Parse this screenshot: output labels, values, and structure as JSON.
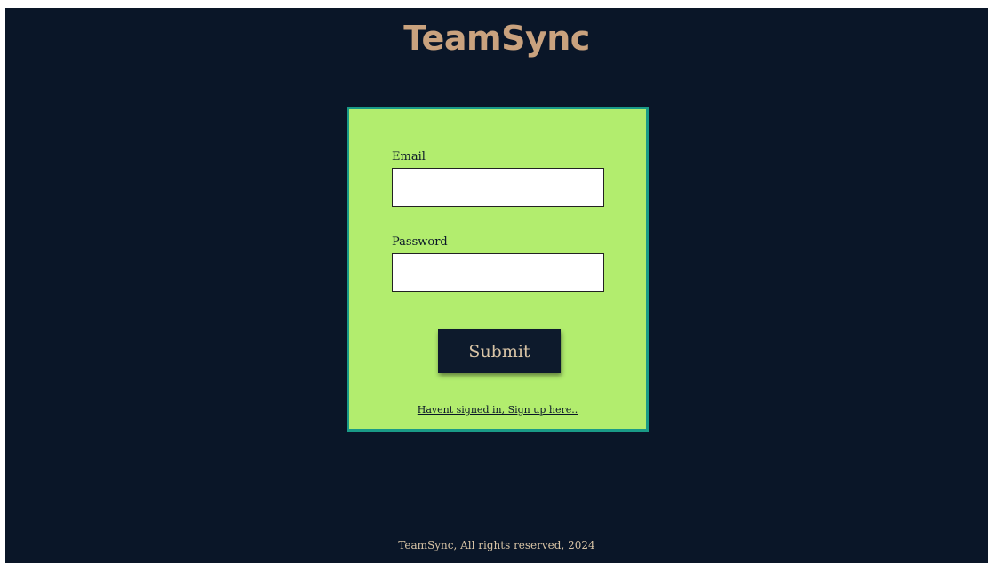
{
  "header": {
    "brand": "TeamSync"
  },
  "login_form": {
    "email_label": "Email",
    "email_value": "",
    "password_label": "Password",
    "password_value": "",
    "submit_label": "Submit",
    "signup_link": "Havent signed in, Sign up here.."
  },
  "footer": {
    "text": "TeamSync, All rights reserved, 2024"
  },
  "colors": {
    "background": "#0a1628",
    "brand": "#c9a27e",
    "card": "#b2ed6e",
    "card_border": "#1a9a87",
    "button": "#0d1a2c"
  }
}
